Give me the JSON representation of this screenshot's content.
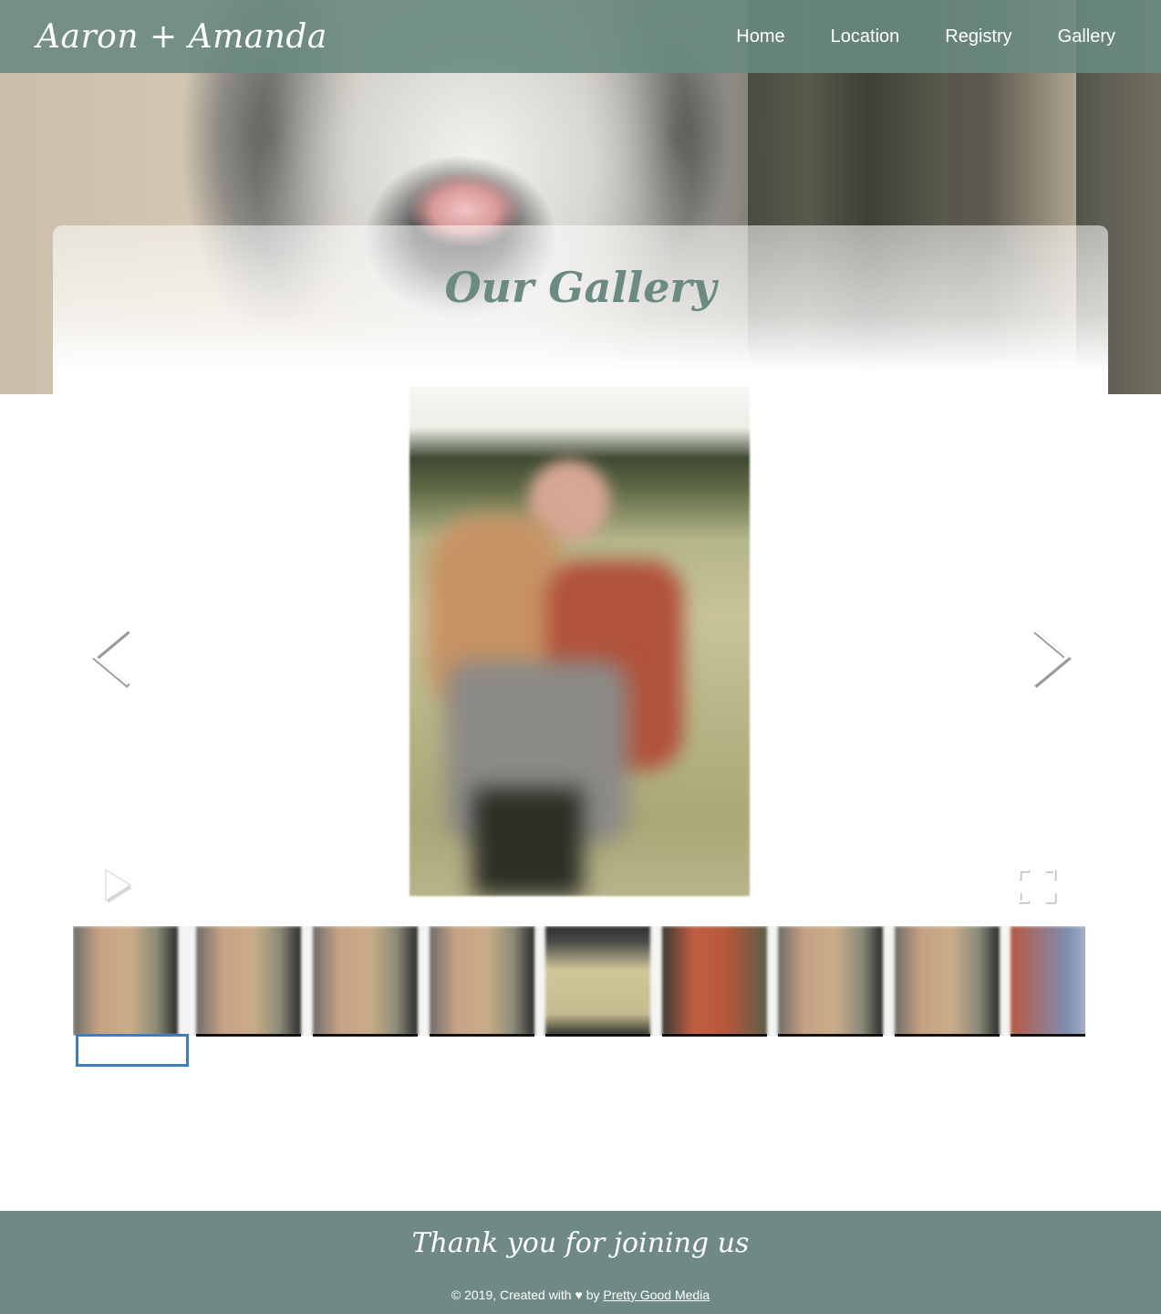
{
  "header": {
    "brand": "Aaron + Amanda",
    "nav": [
      {
        "label": "Home"
      },
      {
        "label": "Location"
      },
      {
        "label": "Registry"
      },
      {
        "label": "Gallery"
      }
    ]
  },
  "page": {
    "title": "Our Gallery"
  },
  "gallery": {
    "selected_index": 0,
    "thumbnail_count": 9,
    "icons": {
      "prev": "chevron-left-icon",
      "next": "chevron-right-icon",
      "play": "play-icon",
      "fullscreen": "fullscreen-icon"
    }
  },
  "footer": {
    "tagline": "Thank you for joining us",
    "credit_prefix": "© 2019, Created with ♥ by",
    "credit_link": "Pretty Good Media"
  },
  "colors": {
    "brand_green": "#6f8a84",
    "title_green": "#6b8a83",
    "selection_blue": "#3a7ec0"
  }
}
